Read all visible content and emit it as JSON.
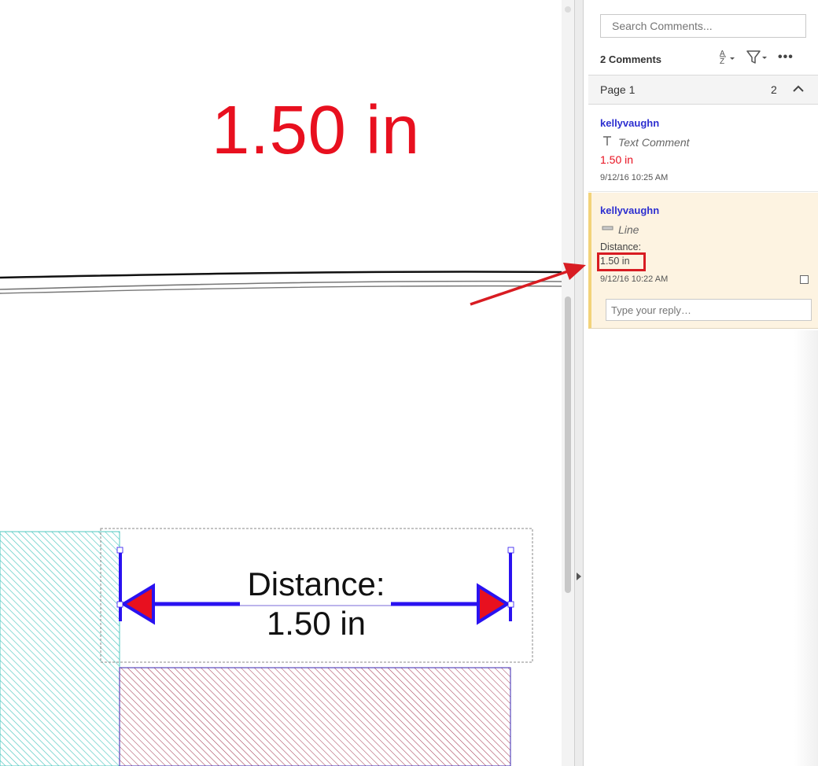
{
  "document": {
    "big_text": "1.50 in",
    "distance_label_line1": "Distance:",
    "distance_label_line2": "1.50 in"
  },
  "panel": {
    "search_placeholder": "Search Comments...",
    "count_label": "2 Comments",
    "sort_icon": "sort-az-icon",
    "filter_icon": "filter-icon",
    "more_icon": "more-icon",
    "page_label": "Page 1",
    "page_count": "2",
    "comments": [
      {
        "author": "kellyvaughn",
        "type": "Text Comment",
        "type_icon": "text-comment-icon",
        "text": "1.50 in",
        "date": "9/12/16  10:25 AM"
      },
      {
        "author": "kellyvaughn",
        "type": "Line",
        "type_icon": "line-icon",
        "text_label": "Distance:",
        "text_value": "1.50 in",
        "date": "9/12/16  10:22 AM",
        "reply_placeholder": "Type your reply…"
      }
    ]
  },
  "colors": {
    "red": "#e8101f",
    "author_blue": "#2d2fd0",
    "measure_blue": "#2a12f0",
    "highlight_bg": "#fdf3e1",
    "teal_hatch": "#4fc8c0",
    "maroon_hatch": "#a0304a"
  }
}
